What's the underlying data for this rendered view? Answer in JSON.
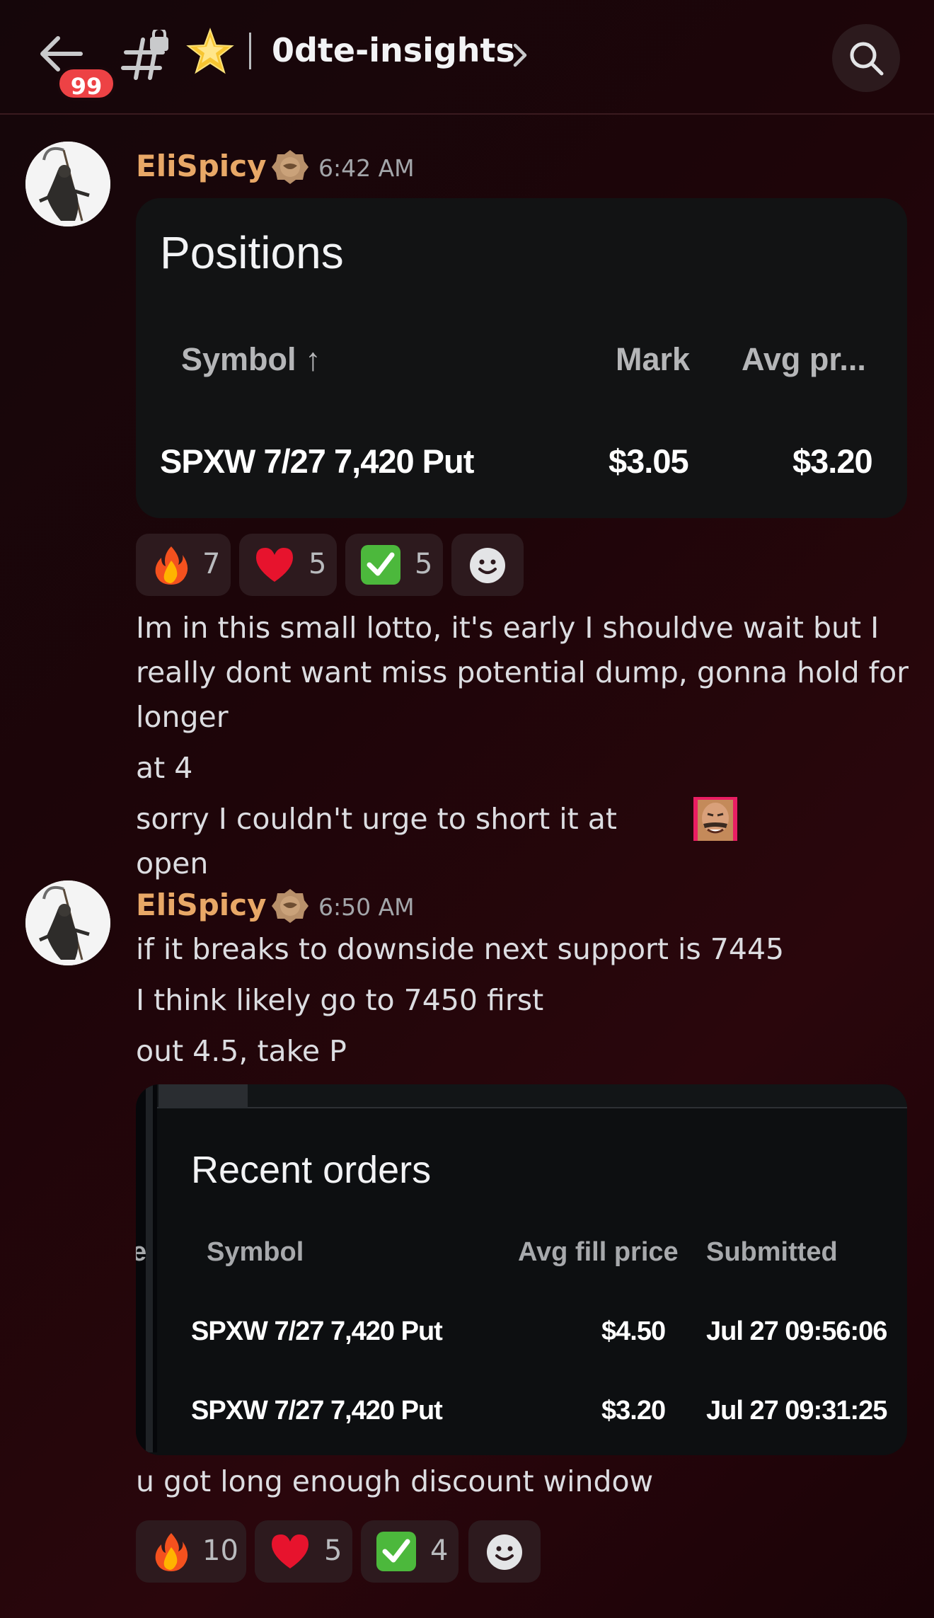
{
  "header": {
    "unread_badge": "99",
    "channel_name": "0dte-insights"
  },
  "messages": [
    {
      "username": "EliSpicy",
      "time": "6:42 AM",
      "positions_card": {
        "title": "Positions",
        "col_symbol": "Symbol ↑",
        "col_mark": "Mark",
        "col_avg": "Avg pr...",
        "row": {
          "symbol": "SPXW 7/27 7,420 Put",
          "mark": "$3.05",
          "avg": "$3.20"
        }
      },
      "reactions": [
        {
          "emoji": "fire-emoji",
          "count": "7"
        },
        {
          "emoji": "heart-emoji",
          "count": "5"
        },
        {
          "emoji": "check-emoji",
          "count": "5"
        }
      ],
      "text_lines": [
        "Im in this small lotto, it's early I shouldve wait but I",
        "really dont want miss potential dump, gonna hold for",
        "longer",
        "at 4",
        "sorry I couldn't urge to short it at open"
      ]
    },
    {
      "username": "EliSpicy",
      "time": "6:50 AM",
      "text_lines": [
        "if it breaks to downside next support is 7445",
        "I think likely go to 7450 first",
        "out 4.5, take P"
      ],
      "orders_card": {
        "title": "Recent orders",
        "edge_char": "e",
        "col_symbol": "Symbol",
        "col_fill": "Avg fill price",
        "col_submitted": "Submitted",
        "rows": [
          {
            "symbol": "SPXW 7/27 7,420 Put",
            "fill": "$4.50",
            "submitted": "Jul 27 09:56:06"
          },
          {
            "symbol": "SPXW 7/27 7,420 Put",
            "fill": "$3.20",
            "submitted": "Jul 27 09:31:25"
          }
        ]
      },
      "after_text": "u got long enough discount window",
      "reactions": [
        {
          "emoji": "fire-emoji",
          "count": "10"
        },
        {
          "emoji": "heart-emoji",
          "count": "5"
        },
        {
          "emoji": "check-emoji",
          "count": "4"
        }
      ]
    }
  ],
  "colors": {
    "username": "#e8a867",
    "badge": "#ed4245",
    "background": "#1e0509"
  }
}
